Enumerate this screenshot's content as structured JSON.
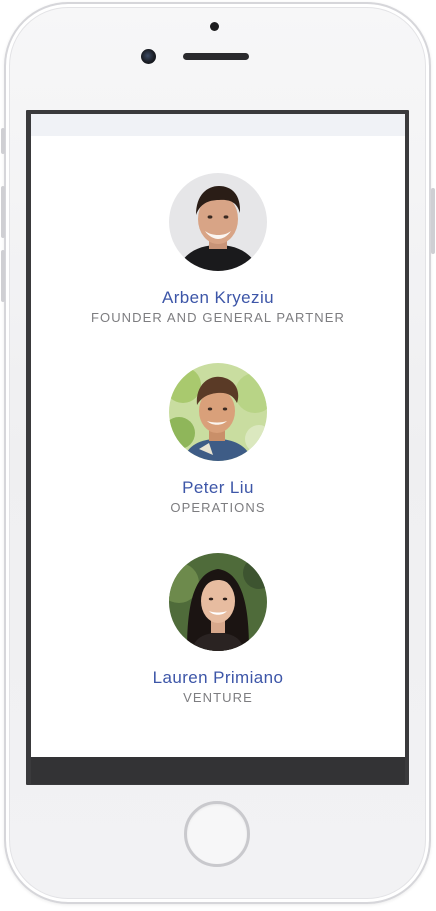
{
  "colors": {
    "name": "#3d56a8",
    "role": "#7d7d80",
    "phone_body": "#f2f2f4",
    "bezel": "#3a3a3c"
  },
  "team": [
    {
      "name": "Arben Kryeziu",
      "role": "FOUNDER AND GENERAL PARTNER",
      "avatar": "portrait-photo-man-dark-hair"
    },
    {
      "name": "Peter Liu",
      "role": "OPERATIONS",
      "avatar": "portrait-photo-man-outdoors"
    },
    {
      "name": "Lauren Primiano",
      "role": "VENTURE",
      "avatar": "portrait-photo-woman-long-hair"
    }
  ]
}
